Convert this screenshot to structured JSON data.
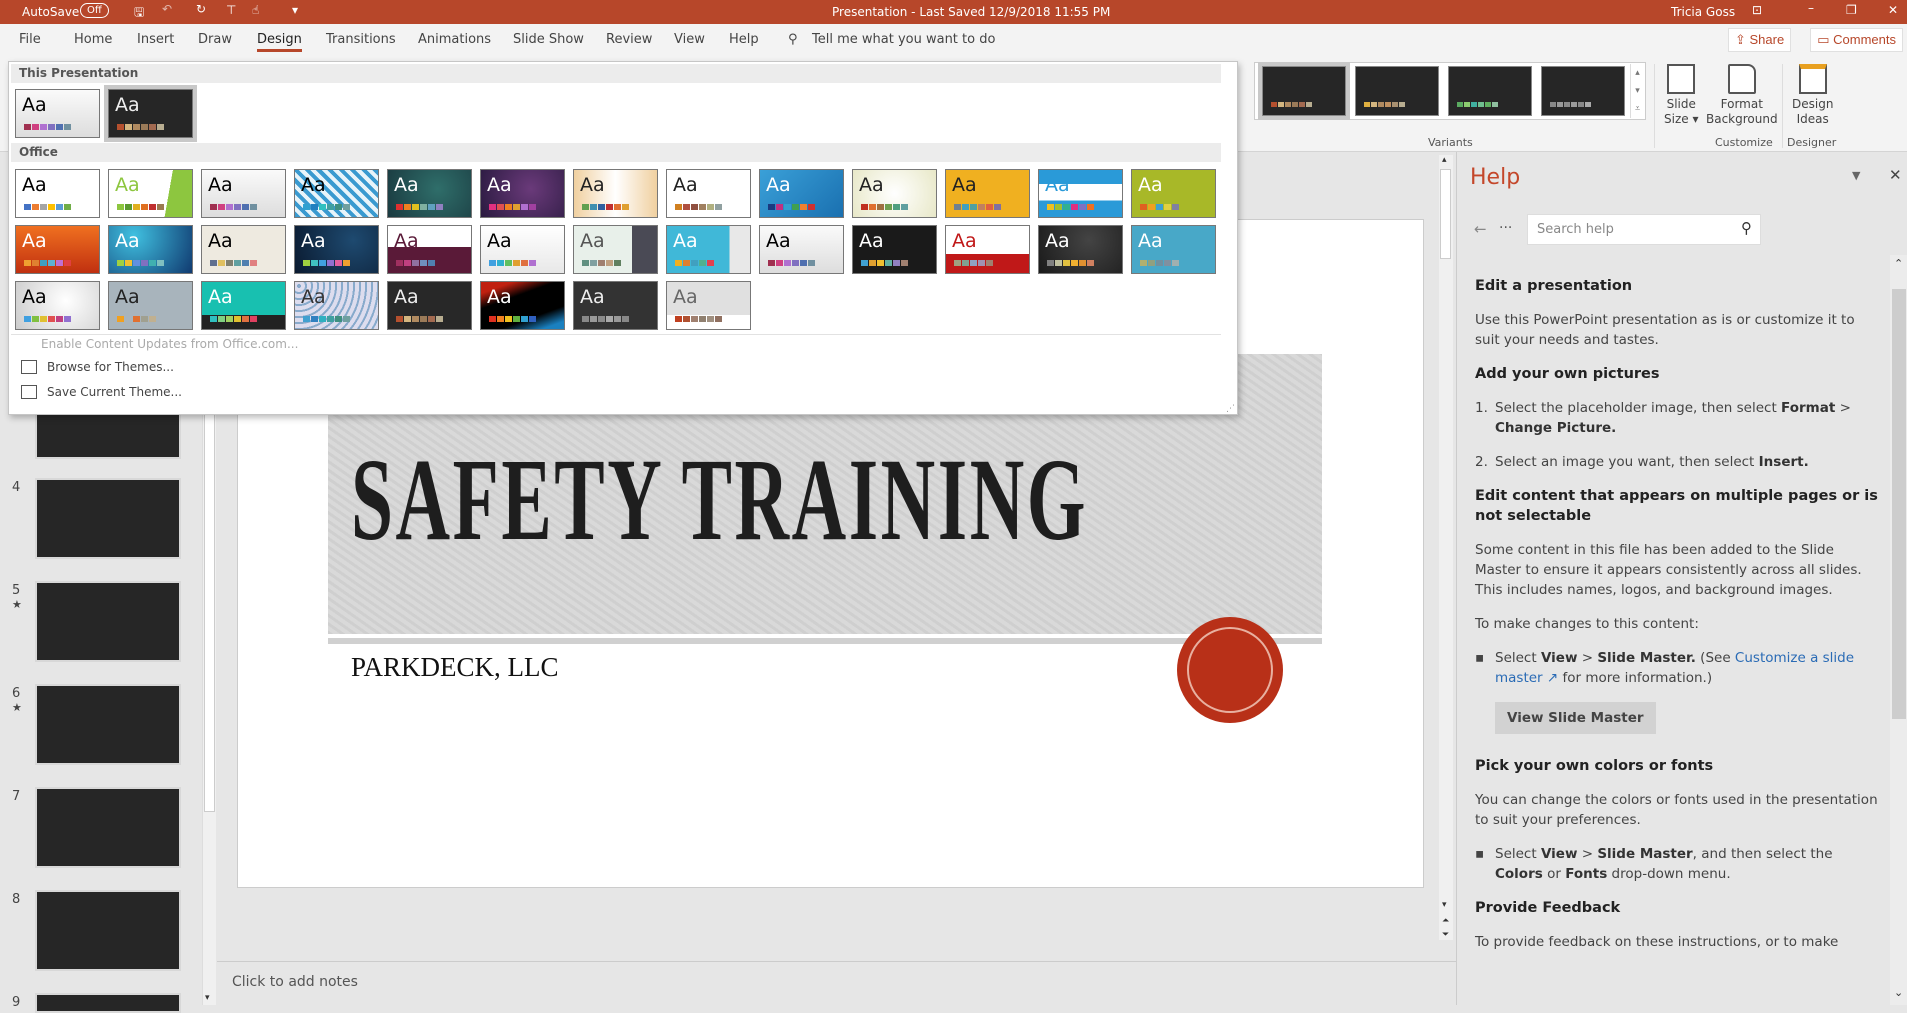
{
  "titlebar": {
    "autosave": "AutoSave",
    "autosave_state": "Off",
    "title": "Presentation  -  Last Saved 12/9/2018 11:55 PM",
    "user": "Tricia Goss",
    "accent": "#b7472a"
  },
  "tabs": [
    "File",
    "Home",
    "Insert",
    "Draw",
    "Design",
    "Transitions",
    "Animations",
    "Slide Show",
    "Review",
    "View",
    "Help"
  ],
  "active_tab": "Design",
  "tell_me": "Tell me what you want to do",
  "share": "Share",
  "comments": "Comments",
  "ribbon": {
    "variants_label": "Variants",
    "customize_label": "Customize",
    "designer_label": "Designer",
    "slide_size": [
      "Slide",
      "Size ▾"
    ],
    "format_background": [
      "Format",
      "Background"
    ],
    "design_ideas": [
      "Design",
      "Ideas"
    ],
    "variants": [
      [
        "#b5502e",
        "#d4b680",
        "#b08a60",
        "#9a7a58",
        "#a36a50",
        "#b8ad90"
      ],
      [
        "#e0b040",
        "#d4b680",
        "#b08a60",
        "#c09060",
        "#a89070",
        "#b8ad90"
      ],
      [
        "#5aaa60",
        "#8ccc70",
        "#40b0a0",
        "#70c090",
        "#60b060",
        "#90c0a0"
      ],
      [
        "#888",
        "#999",
        "#8a8a8a",
        "#9a9a9a",
        "#888",
        "#aaa"
      ]
    ]
  },
  "gallery": {
    "this_presentation": "This Presentation",
    "office": "Office",
    "sample": "Aa",
    "current": [
      {
        "bg": "linear-gradient(#fafafa,#ddd)",
        "fg": "#000",
        "sw": [
          "#a03050",
          "#d04080",
          "#b070d0",
          "#8070c0",
          "#5070b0",
          "#7090a0"
        ]
      },
      {
        "bg": "#262626",
        "fg": "#eee",
        "sw": [
          "#b5502e",
          "#d4b680",
          "#b08a60",
          "#9a7a58",
          "#a36a50",
          "#b8ad90"
        ]
      }
    ],
    "office_themes": [
      {
        "bg": "#fff",
        "fg": "#000",
        "sw": [
          "#4472c4",
          "#ed7d31",
          "#a5a5a5",
          "#ffc000",
          "#5b9bd5",
          "#70ad47"
        ]
      },
      {
        "bg": "linear-gradient(100deg,#fff 70%,#8dc63f 70%)",
        "fg": "#8dc63f",
        "sw": [
          "#8dc63f",
          "#5a9a30",
          "#e0b020",
          "#e07020",
          "#c03030",
          "#9a7a50"
        ]
      },
      {
        "bg": "linear-gradient(#fafafa,#ddd)",
        "fg": "#000",
        "sw": [
          "#a03050",
          "#d04080",
          "#b070d0",
          "#8070c0",
          "#5070b0",
          "#7090a0"
        ]
      },
      {
        "bg": "repeating-linear-gradient(45deg,#3a9ad0 0 4px,#e8f4fa 4px 8px)",
        "fg": "#000",
        "sw": [
          "#30a0d0",
          "#2080c0",
          "#30c0c0",
          "#40a0a0",
          "#409080",
          "#70a0a0"
        ]
      },
      {
        "bg": "radial-gradient(circle at 60% 40%,#2f6e6a,#1a3a40)",
        "fg": "#fff",
        "sw": [
          "#e03030",
          "#f08020",
          "#e0c020",
          "#80b0a0",
          "#60a0c0",
          "#9080c0"
        ]
      },
      {
        "bg": "radial-gradient(circle at 60% 40%,#6a3a7a,#2a1a40)",
        "fg": "#fff",
        "sw": [
          "#e03080",
          "#e05050",
          "#f08020",
          "#e0a030",
          "#b070d0",
          "#a040a0"
        ]
      },
      {
        "bg": "linear-gradient(90deg,#f0d0a0,#fff 50%,#f0d0a0)",
        "fg": "#222",
        "sw": [
          "#60a050",
          "#4090b0",
          "#3060a0",
          "#c03030",
          "#e07030",
          "#e0a030"
        ]
      },
      {
        "bg": "#fff",
        "fg": "#222",
        "sw": [
          "#d08020",
          "#b05040",
          "#905040",
          "#a08060",
          "#b0b080",
          "#90a0a0"
        ]
      },
      {
        "bg": "linear-gradient(135deg,#3aa0d8,#1a70b0)",
        "fg": "#fff",
        "sw": [
          "#1a3a80",
          "#c03080",
          "#30a0d0",
          "#40a050",
          "#f08030",
          "#d03030"
        ]
      },
      {
        "bg": "radial-gradient(circle,#fff,#e8e8c8)",
        "fg": "#222",
        "sw": [
          "#c03020",
          "#e07030",
          "#a07040",
          "#70a050",
          "#50a080",
          "#60a0a0"
        ]
      },
      {
        "bg": "#f0b020",
        "fg": "#222",
        "sw": [
          "#708090",
          "#40a0c0",
          "#50a0a0",
          "#c08060",
          "#e06040",
          "#8070a0"
        ]
      },
      {
        "bg": "linear-gradient(#2a9ad8 30%,#fff 30% 65%,#2a9ad8 65%)",
        "fg": "#2a9ad8",
        "sw": [
          "#f0c020",
          "#a0c030",
          "#30b090",
          "#e03080",
          "#8070c0",
          "#f07020"
        ]
      },
      {
        "bg": "#a8b828",
        "fg": "#fff",
        "sw": [
          "#e06020",
          "#f0a020",
          "#40a0d0",
          "#e0d040",
          "#8080a0"
        ]
      },
      {
        "bg": "linear-gradient(#f07020,#c03010)",
        "fg": "#fff",
        "sw": [
          "#f0a030",
          "#e08030",
          "#40a0c0",
          "#60b0d0",
          "#c070d0",
          "#e04040"
        ]
      },
      {
        "bg": "radial-gradient(circle at 30% 20%,#40c0e0,#103a70)",
        "fg": "#fff",
        "sw": [
          "#a0d040",
          "#f0c030",
          "#6090e0",
          "#8070c0",
          "#40b0b0",
          "#80c0c0"
        ]
      },
      {
        "bg": "#eeeae0",
        "fg": "#000",
        "sw": [
          "#607090",
          "#e0c060",
          "#808070",
          "#60a0a0",
          "#5080b0",
          "#e08080"
        ]
      },
      {
        "bg": "radial-gradient(circle at 70% 30%,#1e4a70,#0a1a30)",
        "fg": "#fff",
        "sw": [
          "#a0d040",
          "#40c0c0",
          "#40a0e0",
          "#9070d0",
          "#e060a0",
          "#f0a030"
        ]
      },
      {
        "bg": "linear-gradient(#fff 45%,#5a1a38 45%)",
        "fg": "#5a1a38",
        "sw": [
          "#a03060",
          "#c04080",
          "#9070a0",
          "#7090c0",
          "#5080b0"
        ]
      },
      {
        "bg": "linear-gradient(#fff,#e8e8e8)",
        "fg": "#000",
        "sw": [
          "#40a0e0",
          "#30b0d0",
          "#60c060",
          "#e0a030",
          "#e07040",
          "#b070d0"
        ]
      },
      {
        "bg": "linear-gradient(90deg,#e8f0ea 70%,#4a4a55 70%)",
        "fg": "#555",
        "sw": [
          "#609080",
          "#80a0a0",
          "#a08070",
          "#c0a080",
          "#608060"
        ]
      },
      {
        "bg": "linear-gradient(90deg,#40b8d8 75%,#e8e8e8 75%)",
        "fg": "#fff",
        "sw": [
          "#f0b020",
          "#e08030",
          "#40a0c0",
          "#50b090",
          "#e04050"
        ]
      },
      {
        "bg": "linear-gradient(#fafafa,#ddd)",
        "fg": "#000",
        "sw": [
          "#a03050",
          "#d04080",
          "#b070d0",
          "#8070c0",
          "#5070b0",
          "#7090a0"
        ]
      },
      {
        "bg": "#1a1a1a",
        "fg": "#fff",
        "sw": [
          "#40a0d0",
          "#e0a030",
          "#f0c030",
          "#60b0a0",
          "#9080c0",
          "#a08070"
        ]
      },
      {
        "bg": "linear-gradient(#fff 60%,#c01818 60%)",
        "fg": "#c01818",
        "sw": [
          "#a0a080",
          "#80a090",
          "#90a0c0",
          "#a090b0",
          "#a08070"
        ]
      },
      {
        "bg": "radial-gradient(circle at 60% 30%,#444,#1a1a1a)",
        "fg": "#fff",
        "sw": [
          "#808080",
          "#c0c0a0",
          "#e0c040",
          "#f0b030",
          "#e09030",
          "#d08060"
        ]
      },
      {
        "bg": "#48a8c8",
        "fg": "#fff",
        "sw": [
          "#b0b070",
          "#90a080",
          "#7090a0",
          "#8090a0",
          "#a0b0b0"
        ]
      },
      {
        "bg": "radial-gradient(circle at 60% 40%,#fff,#ccc)",
        "fg": "#000",
        "sw": [
          "#40a0e0",
          "#80c040",
          "#e0c030",
          "#e05050",
          "#c04080",
          "#9070d0"
        ]
      },
      {
        "bg": "#a8b4bc",
        "fg": "#222",
        "sw": [
          "#f0a020",
          "#a8b4bc",
          "#e07030",
          "#a0a090",
          "#c0b090"
        ]
      },
      {
        "bg": "linear-gradient(#18c0b0 70%,#222 70%)",
        "fg": "#fff",
        "sw": [
          "#30c0c0",
          "#80d080",
          "#a0d060",
          "#e0c030",
          "#e07040",
          "#e04060"
        ]
      },
      {
        "bg": "repeating-radial-gradient(circle at 4px 4px,#8ac 0 2px,#dde 2px 6px)",
        "fg": "#333",
        "sw": [
          "#40a0d0",
          "#3080c0",
          "#30b0c0",
          "#40a0a0",
          "#409080",
          "#70a0a0"
        ]
      },
      {
        "bg": "#282828",
        "fg": "#eee",
        "sw": [
          "#b5502e",
          "#d4b680",
          "#b08a60",
          "#9a7a58",
          "#a36a50",
          "#b8ad90"
        ]
      },
      {
        "bg": "linear-gradient(160deg,#c02010 15%,#000 35% 70%,#1a80c0 90%)",
        "fg": "#fff",
        "sw": [
          "#e03020",
          "#f08020",
          "#f0c020",
          "#60b040",
          "#30a0d0",
          "#3060c0"
        ]
      },
      {
        "bg": "#333",
        "fg": "#eee",
        "sw": [
          "#888",
          "#999",
          "#8a8a8a",
          "#aaa",
          "#999",
          "#888"
        ]
      },
      {
        "bg": "linear-gradient(#e0e0e0 70%,#fff 70%)",
        "fg": "#666",
        "sw": [
          "#c04020",
          "#b05030",
          "#a08070",
          "#908070",
          "#a09080",
          "#907060"
        ]
      }
    ],
    "selected_index": 36,
    "enable_updates": "Enable Content Updates from Office.com...",
    "browse": "Browse for Themes...",
    "save": "Save Current Theme..."
  },
  "thumbnails": [
    {
      "num": "4",
      "star": ""
    },
    {
      "num": "5",
      "star": "★"
    },
    {
      "num": "6",
      "star": "★"
    },
    {
      "num": "7",
      "star": ""
    },
    {
      "num": "8",
      "star": ""
    },
    {
      "num": "9",
      "star": ""
    }
  ],
  "slide": {
    "title": "SAFETY TRAINING",
    "subtitle": "PARKDECK, LLC",
    "seal_color": "#b83018"
  },
  "notes_placeholder": "Click to add notes",
  "help": {
    "title": "Help",
    "search_placeholder": "Search help",
    "blocks": [
      {
        "type": "h",
        "segs": [
          {
            "t": "Edit a presentation"
          }
        ]
      },
      {
        "type": "p",
        "segs": [
          {
            "t": "Use this PowerPoint presentation as is or customize it to suit your needs and tastes."
          }
        ]
      },
      {
        "type": "h",
        "segs": [
          {
            "t": "Add your own pictures"
          }
        ]
      },
      {
        "type": "li",
        "n": "1.",
        "segs": [
          {
            "t": "Select the placeholder image, then select "
          },
          {
            "t": "Format",
            "b": 1
          },
          {
            "t": " > "
          },
          {
            "t": "Change Picture.",
            "b": 1
          }
        ]
      },
      {
        "type": "li",
        "n": "2.",
        "segs": [
          {
            "t": "Select an image you want, then select "
          },
          {
            "t": "Insert.",
            "b": 1
          }
        ]
      },
      {
        "type": "h",
        "segs": [
          {
            "t": "Edit content that appears on multiple pages or is not selectable"
          }
        ]
      },
      {
        "type": "p",
        "segs": [
          {
            "t": "Some content in this file has been added to the Slide Master to ensure it appears consistently across all slides. This includes names, logos, and background images."
          }
        ]
      },
      {
        "type": "p",
        "segs": [
          {
            "t": "To make changes to this content:"
          }
        ]
      },
      {
        "type": "li",
        "n": "▪",
        "segs": [
          {
            "t": "Select "
          },
          {
            "t": "View",
            "b": 1
          },
          {
            "t": " > "
          },
          {
            "t": "Slide Master.",
            "b": 1
          },
          {
            "t": " (See "
          },
          {
            "t": "Customize a slide master ↗",
            "a": 1
          },
          {
            "t": " for more information.)"
          }
        ]
      },
      {
        "type": "btn",
        "segs": [
          {
            "t": "View Slide Master"
          }
        ]
      },
      {
        "type": "h",
        "segs": [
          {
            "t": "Pick your own colors or fonts"
          }
        ]
      },
      {
        "type": "p",
        "segs": [
          {
            "t": "You can change the colors or fonts used in the presentation to suit your preferences."
          }
        ]
      },
      {
        "type": "li",
        "n": "▪",
        "segs": [
          {
            "t": "Select "
          },
          {
            "t": "View",
            "b": 1
          },
          {
            "t": " > "
          },
          {
            "t": "Slide Master",
            "b": 1
          },
          {
            "t": ", and then select the "
          },
          {
            "t": "Colors",
            "b": 1
          },
          {
            "t": " or "
          },
          {
            "t": "Fonts",
            "b": 1
          },
          {
            "t": " drop-down menu."
          }
        ]
      },
      {
        "type": "h",
        "segs": [
          {
            "t": "Provide Feedback"
          }
        ]
      },
      {
        "type": "p",
        "segs": [
          {
            "t": "To provide feedback on these instructions, or to make"
          }
        ]
      }
    ]
  }
}
